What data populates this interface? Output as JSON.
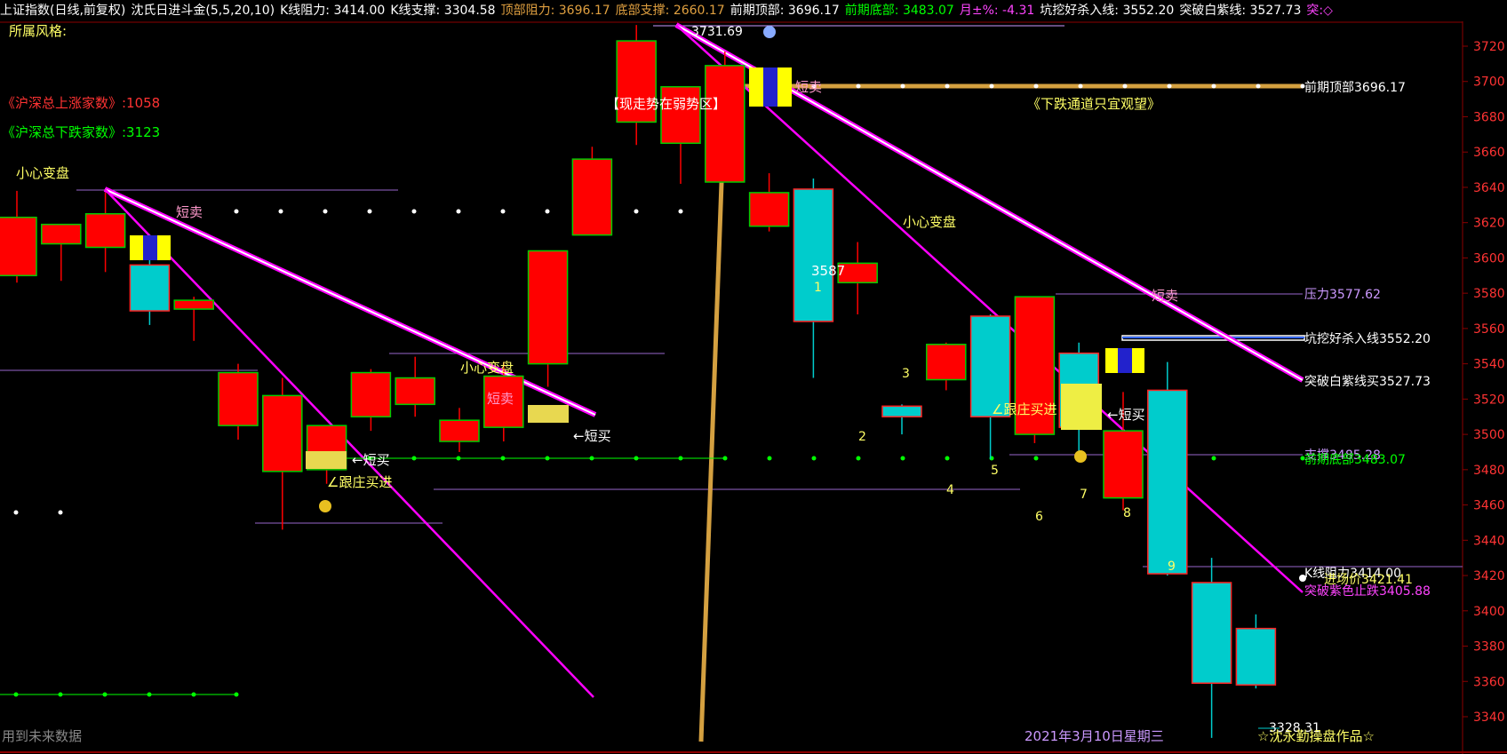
{
  "header": {
    "index_name": "上证指数(日线,前复权)",
    "indicator": "沈氏日进斗金(5,5,20,10)",
    "k_resist": "K线阻力: 3414.00",
    "k_support": "K线支撑: 3304.58",
    "top_resist": "顶部阻力: 3696.17",
    "bottom_support": "底部支撑: 2660.17",
    "prev_top": "前期顶部: 3696.17",
    "prev_bottom": "前期底部: 3483.07",
    "month_pct": "月±%: -4.31",
    "pit_line": "坑挖好杀入线: 3552.20",
    "break_white": "突破白紫线: 3527.73",
    "tail": "突:◇"
  },
  "side_labels": {
    "style": "所属风格:",
    "up_count": "《沪深总上涨家数》:1058",
    "down_count": "《沪深总下跌家数》:3123",
    "future_note": "用到未来数据",
    "date": "2021年3月10日星期三",
    "signature": "☆沈永勤操盘作品☆"
  },
  "annotations": {
    "caution1": "小心变盘",
    "caution2": "小心变盘",
    "caution3": "小心变盘",
    "weak_zone": "【现走势在弱势区】",
    "down_channel": "《下跌通道只宜观望》",
    "short_sell1": "短卖",
    "short_sell2": "短卖",
    "short_sell3": "短卖",
    "short_sell4": "短卖",
    "short_buy1": "←短买",
    "short_buy2": "←短买",
    "short_buy3": "←短买",
    "follow_buy1": "∠跟庄买进",
    "follow_buy2": "∠跟庄买进",
    "high_mark": "3731.69",
    "low_mark": "3328.31",
    "mid_price": "3587",
    "wave_1": "1",
    "wave_2": "2",
    "wave_3": "3",
    "wave_4": "4",
    "wave_5": "5",
    "wave_6": "6",
    "wave_7": "7",
    "wave_8": "8",
    "wave_9": "9"
  },
  "right_labels": {
    "prev_top": "前期顶部3696.17",
    "pressure": "压力3577.62",
    "pit_line": "坑挖好杀入线3552.20",
    "break_white": "突破白紫线买3527.73",
    "support": "支撑3485.28",
    "prev_bottom": "前期底部3483.07",
    "k_resist": "K线阻力3414.00",
    "entry_price": "进场价3421.41",
    "purple_stop": "突破紫色止跌3405.88"
  },
  "colors": {
    "up": "#ff0000",
    "down": "#00cccc",
    "magenta": "#ff00ff",
    "gold": "#d4a040",
    "label_yellow": "#ffff66",
    "green": "#00ff00",
    "purple_line": "#9966cc",
    "axis": "#8b0000"
  },
  "chart_data": {
    "type": "candlestick",
    "y_axis_ticks": [
      3720,
      3700,
      3680,
      3660,
      3640,
      3620,
      3600,
      3580,
      3560,
      3540,
      3520,
      3500,
      3480,
      3460,
      3440,
      3420,
      3400,
      3380,
      3360,
      3340
    ],
    "ylim": [
      3318,
      3738
    ],
    "candles": [
      {
        "o": 3590,
        "h": 3638,
        "l": 3586,
        "c": 3623
      },
      {
        "o": 3608,
        "h": 3618,
        "l": 3587,
        "c": 3619
      },
      {
        "o": 3606,
        "h": 3637,
        "l": 3592,
        "c": 3625
      },
      {
        "o": 3596,
        "h": 3613,
        "l": 3562,
        "c": 3570
      },
      {
        "o": 3571,
        "h": 3578,
        "l": 3553,
        "c": 3576
      },
      {
        "o": 3505,
        "h": 3540,
        "l": 3497,
        "c": 3535
      },
      {
        "o": 3479,
        "h": 3532,
        "l": 3446,
        "c": 3522
      },
      {
        "o": 3480,
        "h": 3505,
        "l": 3472,
        "c": 3505
      },
      {
        "o": 3510,
        "h": 3537,
        "l": 3502,
        "c": 3535
      },
      {
        "o": 3517,
        "h": 3544,
        "l": 3510,
        "c": 3532
      },
      {
        "o": 3496,
        "h": 3515,
        "l": 3490,
        "c": 3508
      },
      {
        "o": 3504,
        "h": 3541,
        "l": 3496,
        "c": 3533
      },
      {
        "o": 3540,
        "h": 3604,
        "l": 3527,
        "c": 3604
      },
      {
        "o": 3613,
        "h": 3663,
        "l": 3613,
        "c": 3656
      },
      {
        "o": 3677,
        "h": 3732,
        "l": 3664,
        "c": 3723
      },
      {
        "o": 3665,
        "h": 3697,
        "l": 3642,
        "c": 3697
      },
      {
        "o": 3643,
        "h": 3717,
        "l": 3643,
        "c": 3709
      },
      {
        "o": 3618,
        "h": 3648,
        "l": 3615,
        "c": 3637
      },
      {
        "o": 3639,
        "h": 3645,
        "l": 3532,
        "c": 3564
      },
      {
        "o": 3586,
        "h": 3609,
        "l": 3568,
        "c": 3597
      },
      {
        "o": 3516,
        "h": 3517,
        "l": 3500,
        "c": 3510
      },
      {
        "o": 3531,
        "h": 3552,
        "l": 3525,
        "c": 3551
      },
      {
        "o": 3567,
        "h": 3568,
        "l": 3486,
        "c": 3510
      },
      {
        "o": 3500,
        "h": 3578,
        "l": 3495,
        "c": 3578
      },
      {
        "o": 3546,
        "h": 3552,
        "l": 3490,
        "c": 3504
      },
      {
        "o": 3464,
        "h": 3524,
        "l": 3457,
        "c": 3502
      },
      {
        "o": 3525,
        "h": 3541,
        "l": 3420,
        "c": 3421
      },
      {
        "o": 3416,
        "h": 3430,
        "l": 3328,
        "c": 3359
      },
      {
        "o": 3390,
        "h": 3398,
        "l": 3356,
        "c": 3358
      }
    ]
  }
}
